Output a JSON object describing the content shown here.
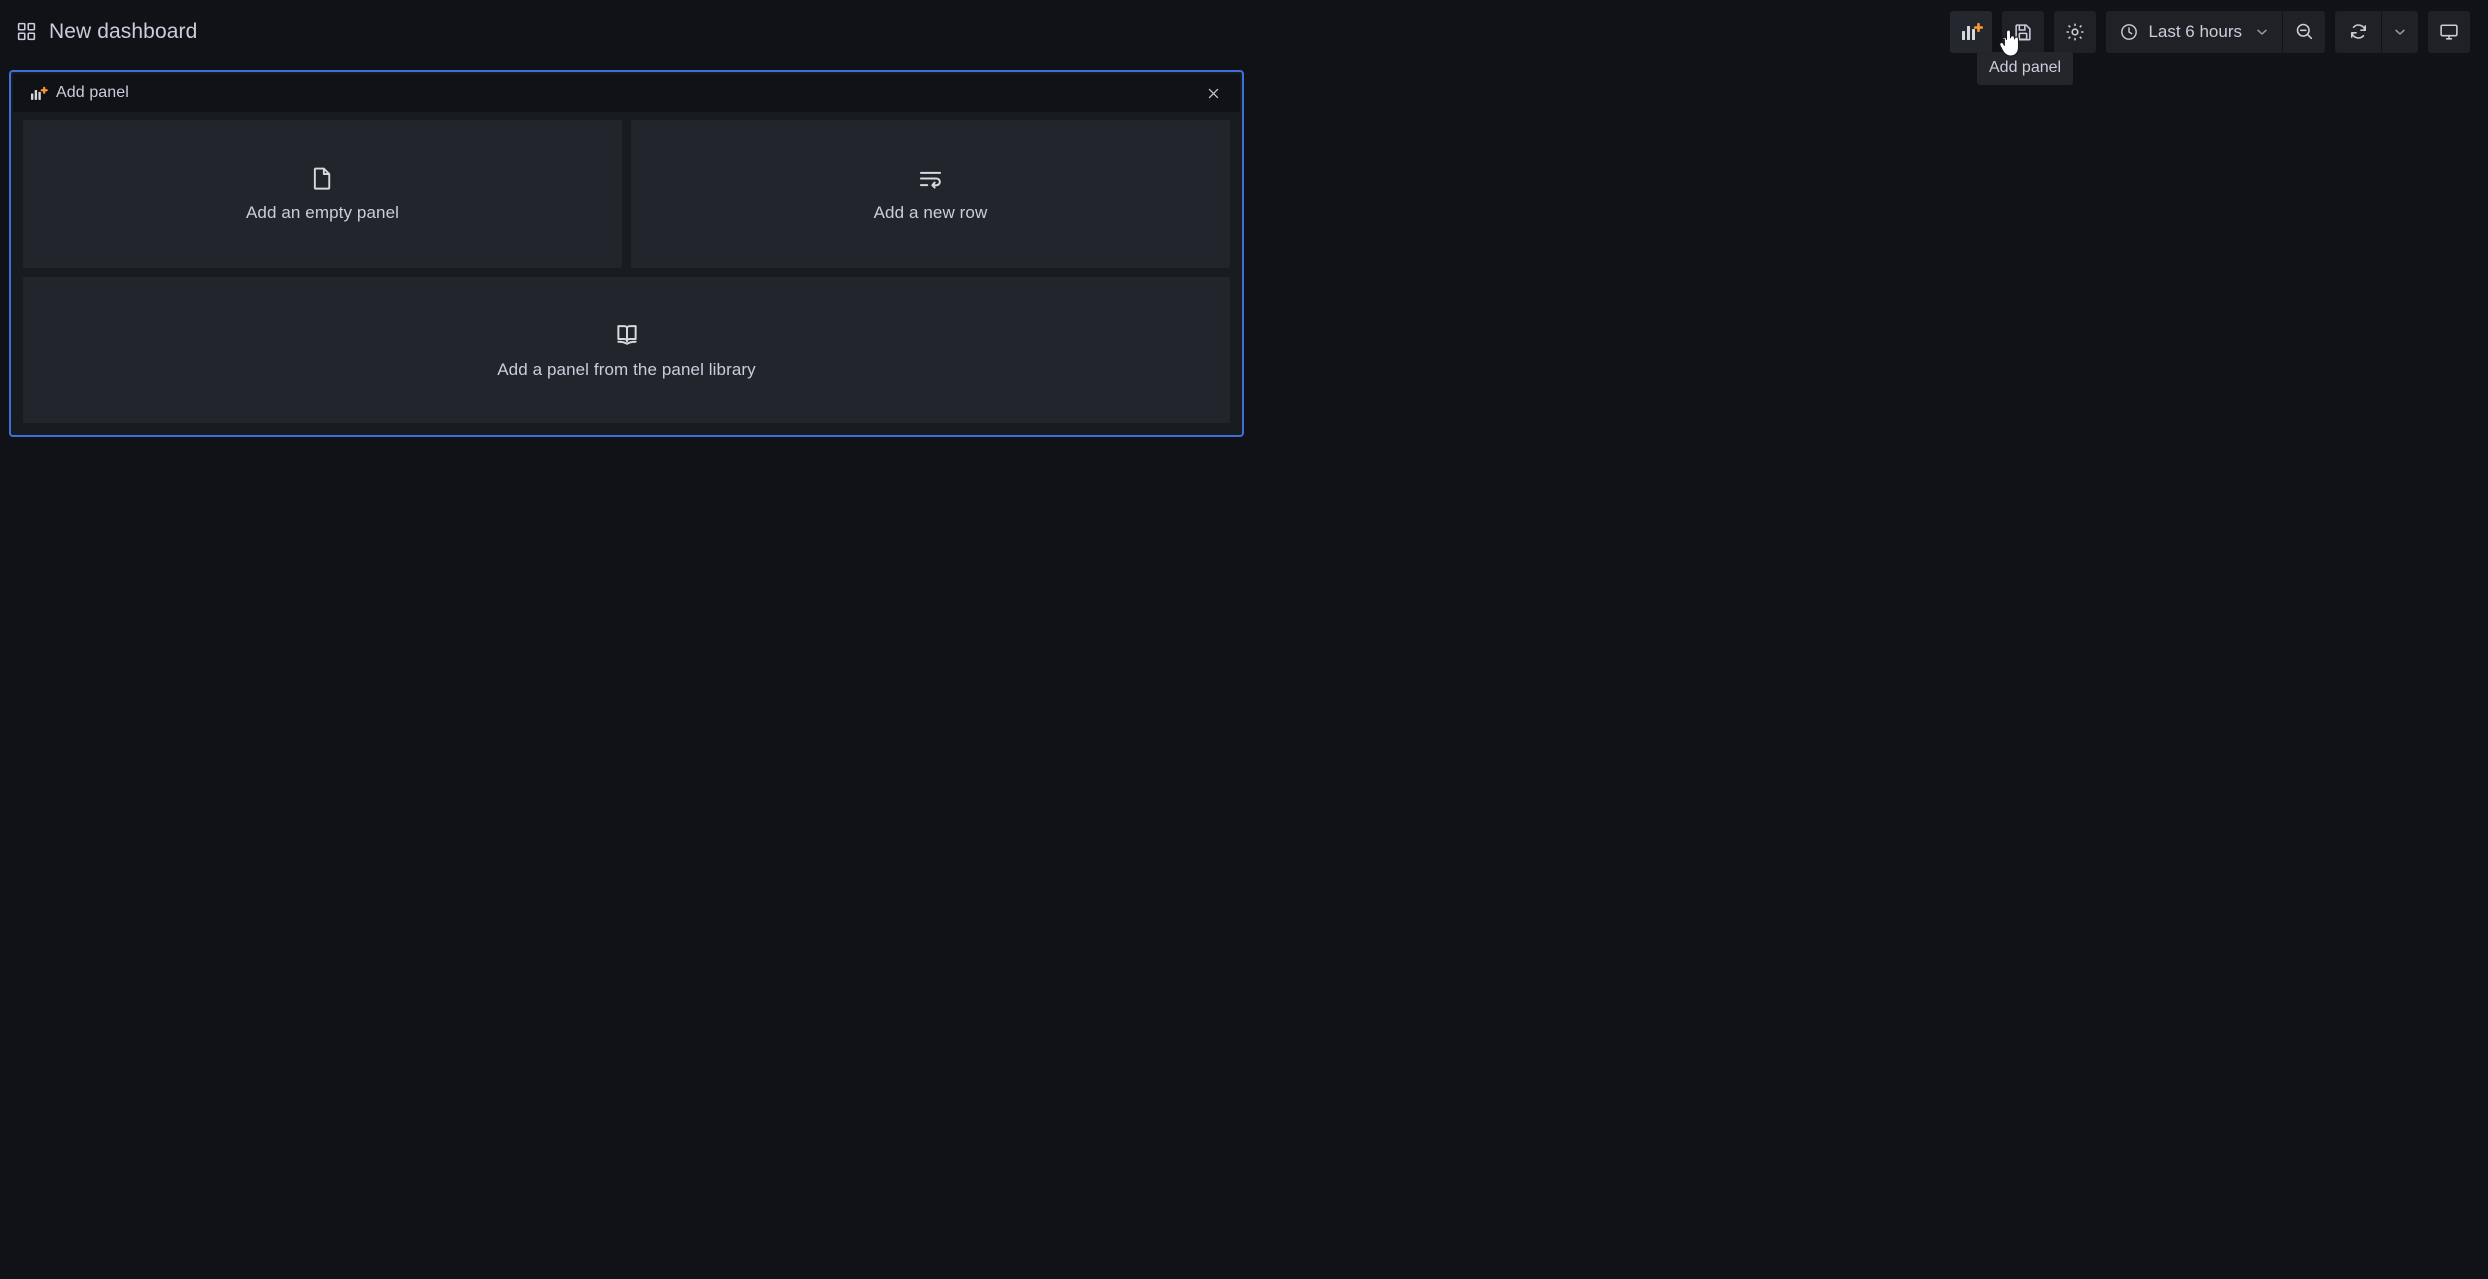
{
  "navbar": {
    "grid_icon": "apps-grid-icon",
    "title": "New dashboard",
    "actions": {
      "add_panel": {
        "icon": "bar-chart-plus-icon",
        "tooltip": "Add panel"
      },
      "save": {
        "icon": "save-floppy-icon"
      },
      "settings": {
        "icon": "gear-icon"
      },
      "time_range": {
        "icon": "clock-icon",
        "value": "Last 6 hours",
        "chevron": "chevron-down-icon"
      },
      "zoom_out": {
        "icon": "zoom-out-icon"
      },
      "refresh": {
        "icon": "refresh-icon",
        "chevron": "chevron-down-icon"
      },
      "kiosk": {
        "icon": "monitor-tv-icon"
      }
    }
  },
  "add_panel_widget": {
    "header": {
      "icon": "bar-chart-plus-icon",
      "title": "Add panel",
      "close_icon": "close-icon"
    },
    "options": [
      {
        "icon": "file-document-icon",
        "label": "Add an empty panel"
      },
      {
        "icon": "text-wrap-row-icon",
        "label": "Add a new row"
      },
      {
        "icon": "open-book-icon",
        "label": "Add a panel from the panel library"
      }
    ]
  },
  "colors": {
    "page_background": "#111217",
    "panel_background": "#181b1f",
    "card_background": "#22252b",
    "focus_border": "#3d71d9",
    "text_primary": "#ccccdc",
    "accent_orange": "#ff9830"
  }
}
